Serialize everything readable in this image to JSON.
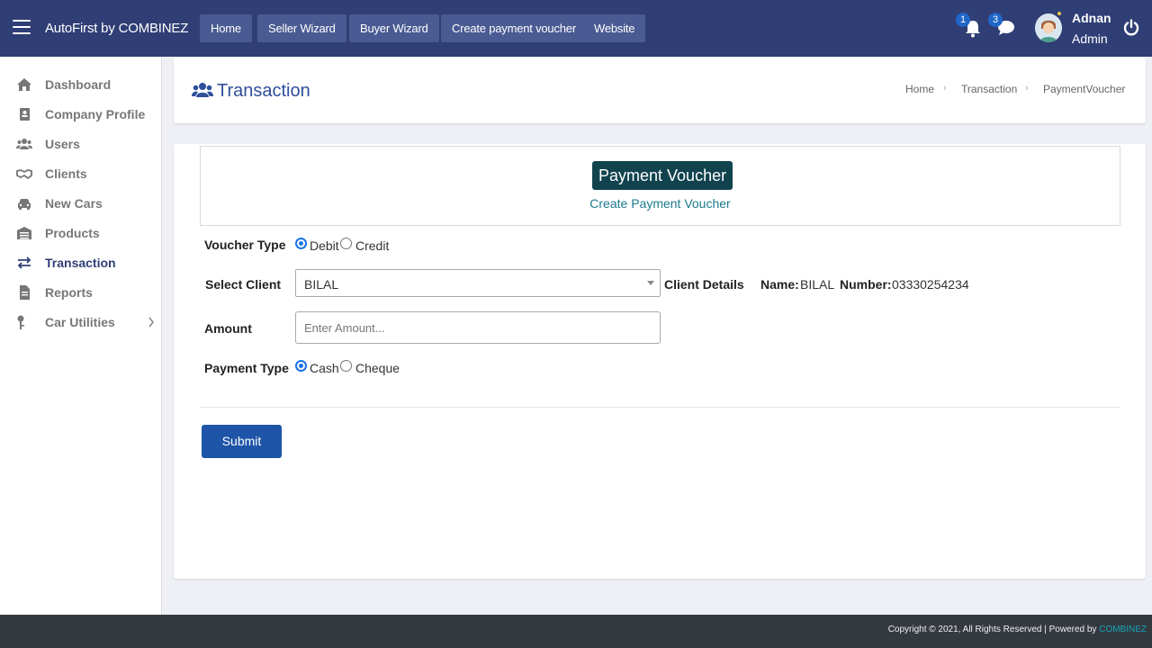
{
  "topbar": {
    "brand": "AutoFirst by COMBINEZ",
    "nav": [
      "Home",
      "Seller Wizard",
      "Buyer Wizard",
      "Create payment voucher",
      "Website"
    ],
    "notifications_count": "1",
    "messages_count": "3",
    "user_name": "Adnan",
    "user_role": "Admin"
  },
  "sidebar": {
    "items": [
      {
        "label": "Dashboard",
        "icon": "home-icon"
      },
      {
        "label": "Company Profile",
        "icon": "id-badge-icon"
      },
      {
        "label": "Users",
        "icon": "users-icon"
      },
      {
        "label": "Clients",
        "icon": "handshake-icon"
      },
      {
        "label": "New Cars",
        "icon": "car-icon"
      },
      {
        "label": "Products",
        "icon": "warehouse-icon"
      },
      {
        "label": "Transaction",
        "icon": "exchange-icon",
        "active": true
      },
      {
        "label": "Reports",
        "icon": "file-icon"
      },
      {
        "label": "Car Utilities",
        "icon": "key-icon",
        "has_submenu": true
      }
    ]
  },
  "header": {
    "title": "Transaction",
    "breadcrumb": [
      "Home",
      "Transaction",
      "PaymentVoucher"
    ]
  },
  "voucher": {
    "title": "Payment Voucher",
    "subtitle": "Create Payment Voucher"
  },
  "form": {
    "voucher_type_label": "Voucher Type",
    "voucher_type_options": [
      "Debit",
      "Credit"
    ],
    "voucher_type_selected": "Debit",
    "select_client_label": "Select Client",
    "select_client_value": "BILAL",
    "client_details_label": "Client Details",
    "client_name_label": "Name:",
    "client_name_value": "BILAL",
    "client_number_label": "Number:",
    "client_number_value": "03330254234",
    "amount_label": "Amount",
    "amount_placeholder": "Enter Amount...",
    "payment_type_label": "Payment Type",
    "payment_type_options": [
      "Cash",
      "Cheque"
    ],
    "payment_type_selected": "Cash",
    "submit_label": "Submit"
  },
  "footer": {
    "text": "Copyright © 2021, All Rights Reserved | Powered by ",
    "link": "COMBINEZ"
  },
  "colors": {
    "topbar": "#2f3e75",
    "nav_button": "#4a5a92",
    "voucher_badge": "#11434f",
    "submit": "#1f55a8",
    "footer": "#343a40",
    "accent_link": "#17a2b8"
  }
}
